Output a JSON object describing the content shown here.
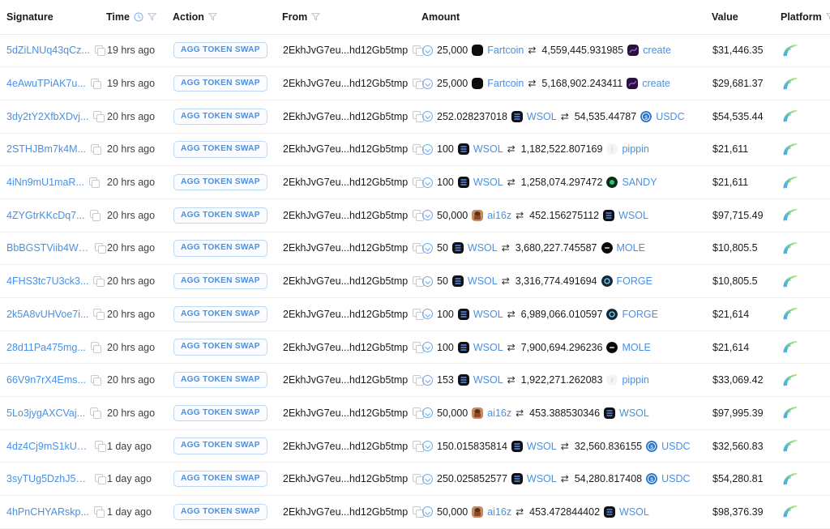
{
  "table": {
    "columns": [
      {
        "key": "signature",
        "label": "Signature",
        "filter": false,
        "clock": false
      },
      {
        "key": "time",
        "label": "Time",
        "filter": true,
        "clock": true
      },
      {
        "key": "action",
        "label": "Action",
        "filter": true,
        "clock": false
      },
      {
        "key": "from",
        "label": "From",
        "filter": true,
        "clock": false
      },
      {
        "key": "amount",
        "label": "Amount",
        "filter": false,
        "clock": false
      },
      {
        "key": "value",
        "label": "Value",
        "filter": false,
        "clock": false
      },
      {
        "key": "platform",
        "label": "Platform",
        "filter": true,
        "clock": false
      }
    ],
    "icons": {
      "copy": "copy-icon",
      "filter": "filter-icon",
      "clock": "clock-icon",
      "expand": "chevron-down-circle-icon",
      "swap": "swap-arrows-icon",
      "platform": "jupiter-logo-icon"
    },
    "swap_glyph": "⇄",
    "rows": [
      {
        "signature": "5dZiLNUq43qCz...",
        "time": "19 hrs ago",
        "action": "AGG TOKEN SWAP",
        "from": "2EkhJvG7eu...hd12Gb5tmp",
        "amount_in": "25,000",
        "token_in": "Fartcoin",
        "token_in_color": "#0d0d0d",
        "amount_out": "4,559,445.931985",
        "token_out": "create",
        "token_out_color": "#2a1140",
        "value": "$31,446.35",
        "platform": "Jupiter"
      },
      {
        "signature": "4eAwuTPiAK7u...",
        "time": "19 hrs ago",
        "action": "AGG TOKEN SWAP",
        "from": "2EkhJvG7eu...hd12Gb5tmp",
        "amount_in": "25,000",
        "token_in": "Fartcoin",
        "token_in_color": "#0d0d0d",
        "amount_out": "5,168,902.243411",
        "token_out": "create",
        "token_out_color": "#2a1140",
        "value": "$29,681.37",
        "platform": "Jupiter"
      },
      {
        "signature": "3dy2tY2XfbXDvj...",
        "time": "20 hrs ago",
        "action": "AGG TOKEN SWAP",
        "from": "2EkhJvG7eu...hd12Gb5tmp",
        "amount_in": "252.028237018",
        "token_in": "WSOL",
        "token_in_color": "#111111",
        "amount_out": "54,535.44787",
        "token_out": "USDC",
        "token_out_color": "#2775ca",
        "value": "$54,535.44",
        "platform": "Jupiter"
      },
      {
        "signature": "2STHJBm7k4M...",
        "time": "20 hrs ago",
        "action": "AGG TOKEN SWAP",
        "from": "2EkhJvG7eu...hd12Gb5tmp",
        "amount_in": "100",
        "token_in": "WSOL",
        "token_in_color": "#111111",
        "amount_out": "1,182,522.807169",
        "token_out": "pippin",
        "token_out_color": "#f2f4f6",
        "value": "$21,611",
        "platform": "Jupiter"
      },
      {
        "signature": "4iNn9mU1maR...",
        "time": "20 hrs ago",
        "action": "AGG TOKEN SWAP",
        "from": "2EkhJvG7eu...hd12Gb5tmp",
        "amount_in": "100",
        "token_in": "WSOL",
        "token_in_color": "#111111",
        "amount_out": "1,258,074.297472",
        "token_out": "SANDY",
        "token_out_color": "#0b2e16",
        "value": "$21,611",
        "platform": "Jupiter"
      },
      {
        "signature": "4ZYGtrKKcDq7...",
        "time": "20 hrs ago",
        "action": "AGG TOKEN SWAP",
        "from": "2EkhJvG7eu...hd12Gb5tmp",
        "amount_in": "50,000",
        "token_in": "ai16z",
        "token_in_color": "#8a4b2a",
        "amount_out": "452.156275112",
        "token_out": "WSOL",
        "token_out_color": "#111111",
        "value": "$97,715.49",
        "platform": "Jupiter"
      },
      {
        "signature": "BbBGSTViib4Wp...",
        "time": "20 hrs ago",
        "action": "AGG TOKEN SWAP",
        "from": "2EkhJvG7eu...hd12Gb5tmp",
        "amount_in": "50",
        "token_in": "WSOL",
        "token_in_color": "#111111",
        "amount_out": "3,680,227.745587",
        "token_out": "MOLE",
        "token_out_color": "#0a0a0a",
        "value": "$10,805.5",
        "platform": "Jupiter"
      },
      {
        "signature": "4FHS3tc7U3ck3...",
        "time": "20 hrs ago",
        "action": "AGG TOKEN SWAP",
        "from": "2EkhJvG7eu...hd12Gb5tmp",
        "amount_in": "50",
        "token_in": "WSOL",
        "token_in_color": "#111111",
        "amount_out": "3,316,774.491694",
        "token_out": "FORGE",
        "token_out_color": "#10283a",
        "value": "$10,805.5",
        "platform": "Jupiter"
      },
      {
        "signature": "2k5A8vUHVoe7i...",
        "time": "20 hrs ago",
        "action": "AGG TOKEN SWAP",
        "from": "2EkhJvG7eu...hd12Gb5tmp",
        "amount_in": "100",
        "token_in": "WSOL",
        "token_in_color": "#111111",
        "amount_out": "6,989,066.010597",
        "token_out": "FORGE",
        "token_out_color": "#10283a",
        "value": "$21,614",
        "platform": "Jupiter"
      },
      {
        "signature": "28d11Pa475mg...",
        "time": "20 hrs ago",
        "action": "AGG TOKEN SWAP",
        "from": "2EkhJvG7eu...hd12Gb5tmp",
        "amount_in": "100",
        "token_in": "WSOL",
        "token_in_color": "#111111",
        "amount_out": "7,900,694.296236",
        "token_out": "MOLE",
        "token_out_color": "#0a0a0a",
        "value": "$21,614",
        "platform": "Jupiter"
      },
      {
        "signature": "66V9n7rX4Ems...",
        "time": "20 hrs ago",
        "action": "AGG TOKEN SWAP",
        "from": "2EkhJvG7eu...hd12Gb5tmp",
        "amount_in": "153",
        "token_in": "WSOL",
        "token_in_color": "#111111",
        "amount_out": "1,922,271.262083",
        "token_out": "pippin",
        "token_out_color": "#f2f4f6",
        "value": "$33,069.42",
        "platform": "Jupiter"
      },
      {
        "signature": "5Lo3jygAXCVaj...",
        "time": "20 hrs ago",
        "action": "AGG TOKEN SWAP",
        "from": "2EkhJvG7eu...hd12Gb5tmp",
        "amount_in": "50,000",
        "token_in": "ai16z",
        "token_in_color": "#8a4b2a",
        "amount_out": "453.388530346",
        "token_out": "WSOL",
        "token_out_color": "#111111",
        "value": "$97,995.39",
        "platform": "Jupiter"
      },
      {
        "signature": "4dz4Cj9mS1kU3...",
        "time": "1 day ago",
        "action": "AGG TOKEN SWAP",
        "from": "2EkhJvG7eu...hd12Gb5tmp",
        "amount_in": "150.015835814",
        "token_in": "WSOL",
        "token_in_color": "#111111",
        "amount_out": "32,560.836155",
        "token_out": "USDC",
        "token_out_color": "#2775ca",
        "value": "$32,560.83",
        "platform": "Jupiter"
      },
      {
        "signature": "3syTUg5DzhJ5Z...",
        "time": "1 day ago",
        "action": "AGG TOKEN SWAP",
        "from": "2EkhJvG7eu...hd12Gb5tmp",
        "amount_in": "250.025852577",
        "token_in": "WSOL",
        "token_in_color": "#111111",
        "amount_out": "54,280.817408",
        "token_out": "USDC",
        "token_out_color": "#2775ca",
        "value": "$54,280.81",
        "platform": "Jupiter"
      },
      {
        "signature": "4hPnCHYARskp...",
        "time": "1 day ago",
        "action": "AGG TOKEN SWAP",
        "from": "2EkhJvG7eu...hd12Gb5tmp",
        "amount_in": "50,000",
        "token_in": "ai16z",
        "token_in_color": "#8a4b2a",
        "amount_out": "453.472844402",
        "token_out": "WSOL",
        "token_out_color": "#111111",
        "value": "$98,376.39",
        "platform": "Jupiter"
      }
    ]
  },
  "colors": {
    "link": "#4a90e2",
    "badge_border": "#bcd9f5",
    "row_divider": "#f0f0f0",
    "text": "#1a1a1a"
  }
}
